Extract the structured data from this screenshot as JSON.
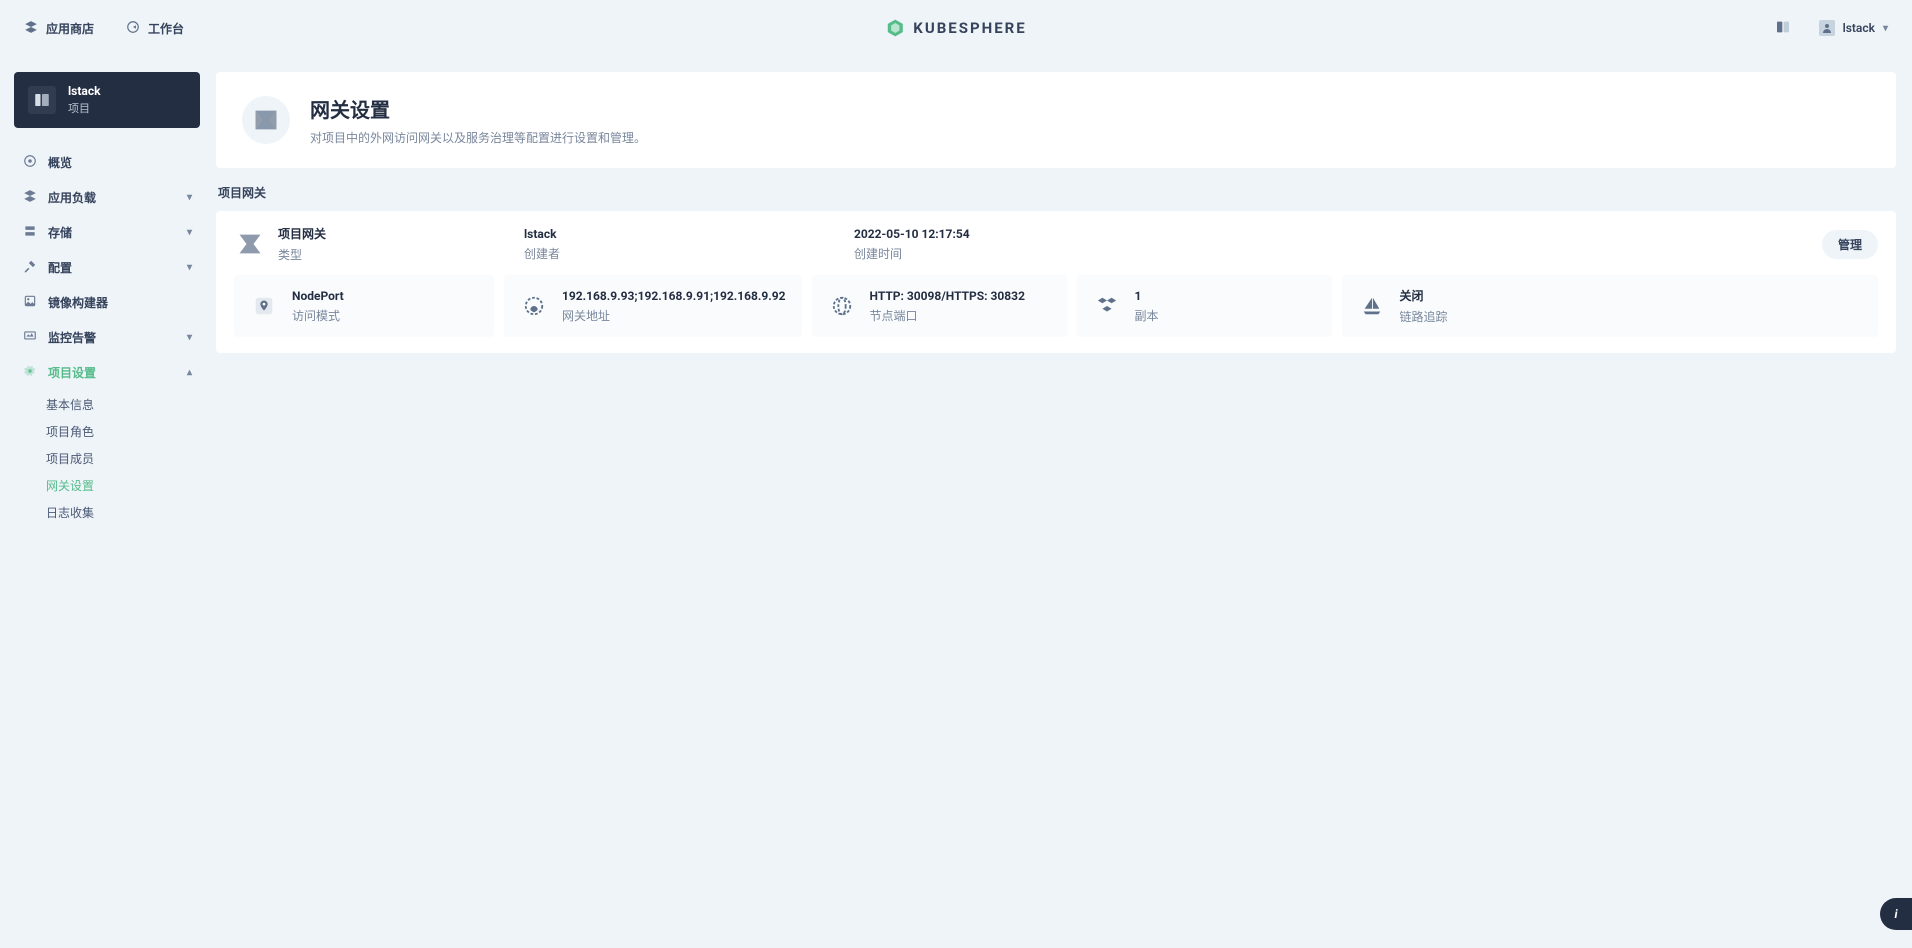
{
  "topbar": {
    "app_store": "应用商店",
    "workbench": "工作台",
    "brand": "KUBESPHERE",
    "user": "lstack"
  },
  "sidebar": {
    "project": {
      "name": "lstack",
      "subtitle": "项目"
    },
    "items": [
      {
        "label": "概览"
      },
      {
        "label": "应用负载",
        "expandable": true
      },
      {
        "label": "存储",
        "expandable": true
      },
      {
        "label": "配置",
        "expandable": true
      },
      {
        "label": "镜像构建器"
      },
      {
        "label": "监控告警",
        "expandable": true
      },
      {
        "label": "项目设置",
        "expandable": true,
        "active": true
      }
    ],
    "project_settings_sub": [
      {
        "label": "基本信息"
      },
      {
        "label": "项目角色"
      },
      {
        "label": "项目成员"
      },
      {
        "label": "网关设置",
        "active": true
      },
      {
        "label": "日志收集"
      }
    ]
  },
  "header": {
    "title": "网关设置",
    "desc": "对项目中的外网访问网关以及服务治理等配置进行设置和管理。"
  },
  "section_label": "项目网关",
  "gateway": {
    "summary": {
      "type": {
        "value": "项目网关",
        "label": "类型"
      },
      "creator": {
        "value": "lstack",
        "label": "创建者"
      },
      "created": {
        "value": "2022-05-10 12:17:54",
        "label": "创建时间"
      }
    },
    "manage_label": "管理",
    "details": {
      "access_mode": {
        "value": "NodePort",
        "label": "访问模式"
      },
      "address": {
        "value": "192.168.9.93;192.168.9.91;192.168.9.92",
        "label": "网关地址"
      },
      "node_port": {
        "value": "HTTP: 30098/HTTPS: 30832",
        "label": "节点端口"
      },
      "replicas": {
        "value": "1",
        "label": "副本"
      },
      "tracing": {
        "value": "关闭",
        "label": "链路追踪"
      }
    }
  },
  "icons": {
    "chevron_down": "▾"
  }
}
